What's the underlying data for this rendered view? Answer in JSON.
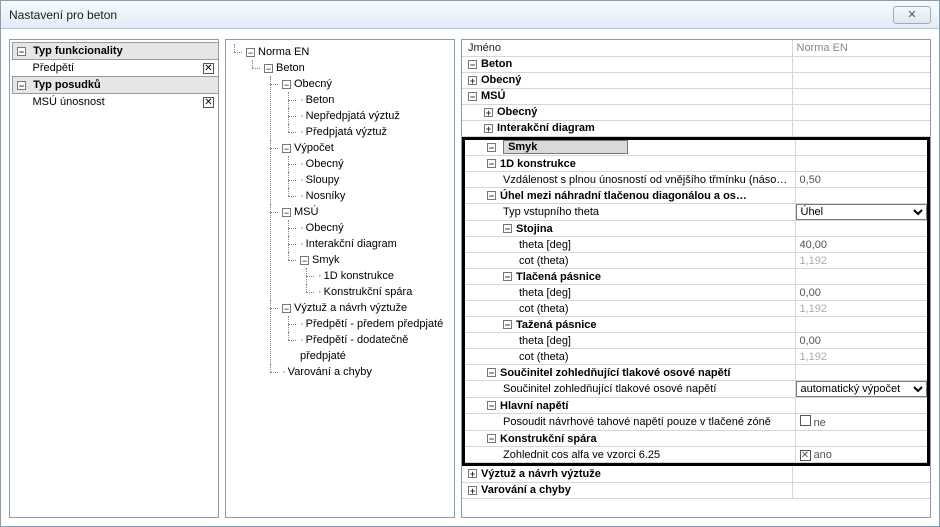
{
  "window": {
    "title": "Nastavení pro beton",
    "close": "✕"
  },
  "left": {
    "sections": [
      {
        "header": "Typ funkcionality",
        "items": [
          {
            "label": "Předpětí",
            "checked": true
          }
        ]
      },
      {
        "header": "Typ posudků",
        "items": [
          {
            "label": "MSÚ únosnost",
            "checked": true
          }
        ]
      }
    ]
  },
  "tree": {
    "root": "Norma EN",
    "beton": "Beton",
    "obecny": "Obecný",
    "obecny_children": [
      "Beton",
      "Nepředpjatá výztuž",
      "Předpjatá výztuž"
    ],
    "vypocet": "Výpočet",
    "vypocet_children": [
      "Obecný",
      "Sloupy",
      "Nosníky"
    ],
    "msu": "MSÚ",
    "msu_obecny": "Obecný",
    "msu_interakcni": "Interakční diagram",
    "smyk": "Smyk",
    "smyk_children": [
      "1D konstrukce",
      "Konstrukční spára"
    ],
    "vyztuz": "Výztuž a návrh výztuže",
    "vyztuz_children": [
      "Předpětí - předem předpjaté",
      "Předpětí - dodatečně předpjaté"
    ],
    "varovani": "Varování a chyby"
  },
  "right": {
    "header_left": "Jméno",
    "header_right": "Norma EN",
    "rows": {
      "beton": "Beton",
      "obecny": "Obecný",
      "msu": "MSÚ",
      "msu_obecny": "Obecný",
      "interakcni": "Interakční diagram",
      "smyk": "Smyk",
      "d1": "1D konstrukce",
      "vzdalenost": "Vzdálenost s plnou únosností od vnějšího třmínku (náso…",
      "vzdalenost_val": "0,50",
      "uhel": "Úhel mezi náhradní tlačenou diagonálou a os…",
      "typ_theta": "Typ vstupního theta",
      "typ_theta_val": "Úhel",
      "stojina": "Stojina",
      "theta_deg": "theta [deg]",
      "cot_theta": "cot (theta)",
      "stojina_theta": "40,00",
      "stojina_cot": "1,192",
      "tlacena": "Tlačená pásnice",
      "tlacena_theta": "0,00",
      "tlacena_cot": "1,192",
      "tazena": "Tažená pásnice",
      "tazena_theta": "0,00",
      "tazena_cot": "1,192",
      "soucinitel_h": "Součinitel zohledňující tlakové osové napětí",
      "soucinitel": "Součinitel zohledňující tlakové osové napětí",
      "soucinitel_val": "automatický výpočet",
      "hlavni": "Hlavní napětí",
      "posoudit": "Posoudit návrhové tahové napětí pouze v tlačené zóně",
      "posoudit_val": "ne",
      "konstrukcni": "Konstrukční spára",
      "zohlednit": "Zohlednit cos  alfa ve vzorci 6.25",
      "zohlednit_val": "ano",
      "vyztuz": "Výztuž a návrh výztuže",
      "varovani": "Varování a chyby"
    }
  }
}
